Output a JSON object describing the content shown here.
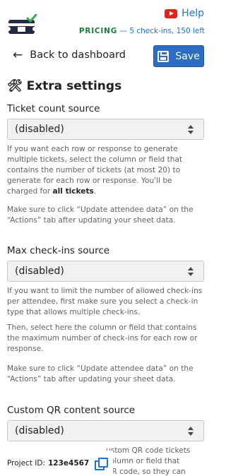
{
  "header": {
    "logo_icon": "ticket-check-logo-icon",
    "help_label": "Help",
    "pricing_label": "PRICING",
    "pricing_detail": "— 5 check-ins, 150 left"
  },
  "topbar": {
    "back_label": "Back to dashboard",
    "save_label": "Save"
  },
  "section": {
    "title": "Extra settings",
    "icon": "tools-icon"
  },
  "fields": [
    {
      "label": "Ticket count source",
      "value": "(disabled)",
      "help": [
        "If you want each row or response to generate multiple tickets, select the column or field that contains the number of tickets (at most 20) to generate for each row or response. You'll be charged for ",
        "all tickets",
        ".",
        "Make sure to click “Update attendee data” on the “Actions” tab after updating your sheet data."
      ]
    },
    {
      "label": "Max check-ins source",
      "value": "(disabled)",
      "help": [
        "If you want to limit the number of allowed check-ins per attendee, first make sure you select a check-in type that allows multiple check-ins.",
        "Then, select here the column or field that contains the maximum number of check-ins for each row or response.",
        "Make sure to click “Update attendee data” on the “Actions” tab after updating your sheet data."
      ]
    },
    {
      "label": "Custom QR content source",
      "value": "(disabled)",
      "help": [
        "ustom QR code tickets",
        "column or field that",
        "QR code, so they can"
      ]
    }
  ],
  "footer": {
    "project_label": "Project ID:",
    "project_id": "123e4567"
  },
  "colors": {
    "accent": "#2b6cc4",
    "link": "#1a73e8",
    "pricing_green": "#188038",
    "youtube_red": "#e62117"
  }
}
